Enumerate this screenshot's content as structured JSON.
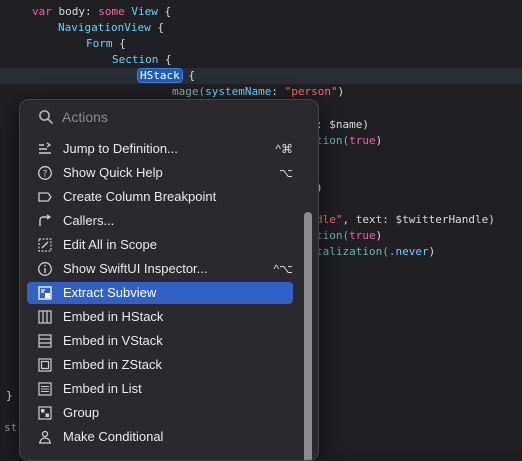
{
  "code": {
    "line1": {
      "kw1": "var",
      "name": " body: ",
      "kw2": "some",
      "ty": " View",
      "rest": " {"
    },
    "line2": {
      "ty": "NavigationView",
      "rest": " {"
    },
    "line3": {
      "ty": "Form",
      "rest": " {"
    },
    "line4": {
      "ty": "Section",
      "rest": " {"
    },
    "line5": {
      "sel": "HStack",
      "rest": " {"
    },
    "line6": {
      "fn": "mage(",
      "label": "systemName",
      "colon": ": ",
      "str": "\"person\"",
      "rest": ")"
    },
    "line7": {
      "text": ": $name)"
    },
    "line8": {
      "fn": "tion(",
      "lit": "true",
      "rest": ")"
    },
    "line9": {
      "text": ")"
    },
    "line10": {
      "str": "dle\"",
      "text": ", text: $twitterHandle)"
    },
    "line11": {
      "fn": "tion(",
      "lit": "true",
      "rest": ")"
    },
    "line12": {
      "fn": "talization(",
      "lit": ".never",
      "rest": ")"
    },
    "line13": {
      "text": "}"
    },
    "line14": {
      "text": "st"
    }
  },
  "menu": {
    "search_placeholder": "Actions",
    "items": [
      {
        "label": "Jump to Definition...",
        "icon": "jump-definition-icon",
        "shortcut": "^⌘"
      },
      {
        "label": "Show Quick Help",
        "icon": "question-circle-icon",
        "shortcut": "⌥"
      },
      {
        "label": "Create Column Breakpoint",
        "icon": "breakpoint-icon",
        "shortcut": ""
      },
      {
        "label": "Callers...",
        "icon": "callers-icon",
        "shortcut": ""
      },
      {
        "label": "Edit All in Scope",
        "icon": "edit-scope-icon",
        "shortcut": ""
      },
      {
        "label": "Show SwiftUI Inspector...",
        "icon": "info-circle-icon",
        "shortcut": "^⌥"
      },
      {
        "label": "Extract Subview",
        "icon": "extract-subview-icon",
        "shortcut": ""
      },
      {
        "label": "Embed in HStack",
        "icon": "hstack-icon",
        "shortcut": ""
      },
      {
        "label": "Embed in VStack",
        "icon": "vstack-icon",
        "shortcut": ""
      },
      {
        "label": "Embed in ZStack",
        "icon": "zstack-icon",
        "shortcut": ""
      },
      {
        "label": "Embed in List",
        "icon": "list-icon",
        "shortcut": ""
      },
      {
        "label": "Group",
        "icon": "group-icon",
        "shortcut": ""
      },
      {
        "label": "Make Conditional",
        "icon": "conditional-icon",
        "shortcut": ""
      }
    ],
    "selected_label": "Extract Subview"
  },
  "colors": {
    "keyword": "#fc5fa3",
    "type": "#5dd8ff",
    "string": "#fc6a5d",
    "selection": "#2f61c7"
  }
}
